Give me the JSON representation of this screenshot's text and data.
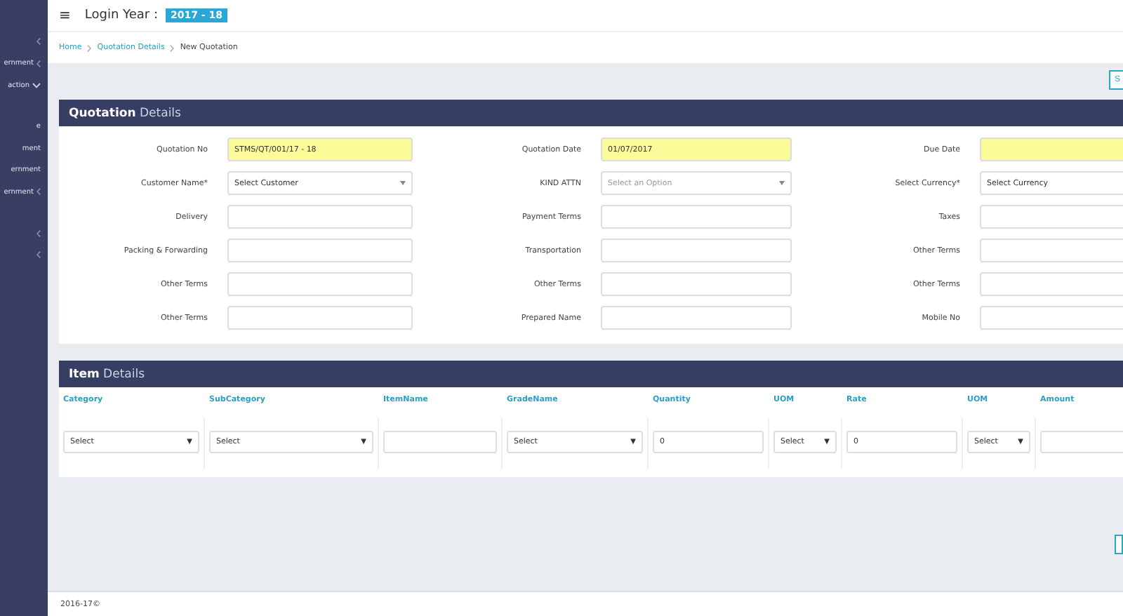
{
  "sidebar": {
    "items": [
      {
        "expanded": false
      },
      {
        "label": "ernment",
        "expanded": false
      },
      {
        "label": "action",
        "expanded": true
      },
      {
        "label": "e"
      },
      {
        "label": "ment"
      },
      {
        "label": "ernment"
      },
      {
        "label": "ernment",
        "expanded": false
      },
      {
        "expanded": false
      },
      {
        "expanded": false
      }
    ]
  },
  "header": {
    "menu_icon": "≡",
    "title": "Login Year :",
    "year_badge": "2017 - 18"
  },
  "breadcrumb": [
    {
      "label": "Home",
      "link": true
    },
    {
      "label": "Quotation Details",
      "link": true
    },
    {
      "label": "New Quotation",
      "link": false
    }
  ],
  "top_button": "S",
  "quotation": {
    "title_bold": "Quotation",
    "title_rest": "Details",
    "fields": [
      {
        "label": "Quotation No",
        "kind": "input",
        "value": "STMS/QT/001/17 - 18",
        "highlighted": true
      },
      {
        "label": "Quotation Date",
        "kind": "input",
        "value": "01/07/2017",
        "highlighted": true
      },
      {
        "label": "Due Date",
        "kind": "input",
        "highlighted": true
      },
      {
        "label": "Customer Name*",
        "kind": "select",
        "value": "Select Customer",
        "highlighted": false
      },
      {
        "label": "KIND ATTN",
        "kind": "select",
        "placeholder": "Select an Option",
        "highlighted": false
      },
      {
        "label": "Select Currency*",
        "kind": "select",
        "value": "Select Currency",
        "highlighted": false
      },
      {
        "label": "Delivery",
        "kind": "input",
        "highlighted": false
      },
      {
        "label": "Payment Terms",
        "kind": "input",
        "highlighted": false
      },
      {
        "label": "Taxes",
        "kind": "input",
        "highlighted": false
      },
      {
        "label": "Packing & Forwarding",
        "kind": "input",
        "highlighted": false
      },
      {
        "label": "Transportation",
        "kind": "input",
        "highlighted": false
      },
      {
        "label": "Other Terms",
        "kind": "input",
        "highlighted": false
      },
      {
        "label": "Other Terms",
        "kind": "input",
        "highlighted": false
      },
      {
        "label": "Other Terms",
        "kind": "input",
        "highlighted": false
      },
      {
        "label": "Other Terms",
        "kind": "input",
        "highlighted": false
      },
      {
        "label": "Other Terms",
        "kind": "input",
        "highlighted": false
      },
      {
        "label": "Prepared Name",
        "kind": "input",
        "highlighted": false
      },
      {
        "label": "Mobile No",
        "kind": "input",
        "highlighted": false
      }
    ]
  },
  "items": {
    "title_bold": "Item",
    "title_rest": "Details",
    "columns": [
      {
        "label": "Category",
        "kind": "select",
        "value": "Select",
        "caret": "▼"
      },
      {
        "label": "SubCategory",
        "kind": "select",
        "value": "Select",
        "caret": "▼"
      },
      {
        "label": "ItemName",
        "kind": "input"
      },
      {
        "label": "GradeName",
        "kind": "select",
        "value": "Select",
        "caret": "▼"
      },
      {
        "label": "Quantity",
        "kind": "input",
        "value": "0"
      },
      {
        "label": "UOM",
        "kind": "select",
        "value": "Select",
        "caret": "▼"
      },
      {
        "label": "Rate",
        "kind": "input",
        "value": "0"
      },
      {
        "label": "UOM",
        "kind": "select",
        "value": "Select",
        "caret": "▼"
      },
      {
        "label": "Amount",
        "kind": "input"
      }
    ]
  },
  "footer": "2016-17©"
}
